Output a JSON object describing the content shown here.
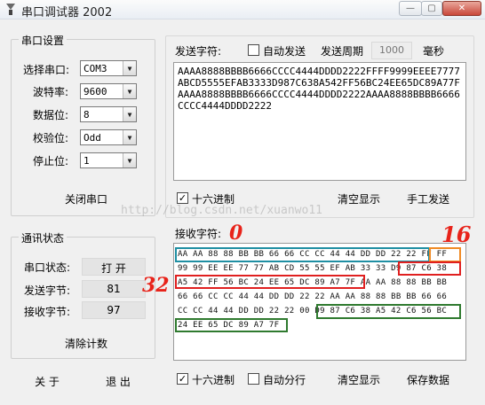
{
  "window": {
    "title": "串口调试器 2002",
    "minimize_glyph": "—",
    "maximize_glyph": "▢",
    "close_glyph": "✕"
  },
  "serial_settings": {
    "legend": "串口设置",
    "port_label": "选择串口:",
    "port_value": "COM3",
    "baud_label": "波特率:",
    "baud_value": "9600",
    "databits_label": "数据位:",
    "databits_value": "8",
    "parity_label": "校验位:",
    "parity_value": "Odd",
    "stopbits_label": "停止位:",
    "stopbits_value": "1",
    "close_port_button": "关闭串口"
  },
  "comm_status": {
    "legend": "通讯状态",
    "port_status_label": "串口状态:",
    "port_status_value": "打 开",
    "sent_bytes_label": "发送字节:",
    "sent_bytes_value": "81",
    "recv_bytes_label": "接收字节:",
    "recv_bytes_value": "97",
    "clear_count_button": "清除计数"
  },
  "bottom_left": {
    "about_button": "关 于",
    "exit_button": "退 出"
  },
  "send_section": {
    "label": "发送字符:",
    "auto_send_label": "自动发送",
    "auto_send_checked": false,
    "period_label": "发送周期",
    "period_value": "1000",
    "period_unit": "毫秒",
    "text": "AAAA8888BBBB6666CCCC4444DDDD2222FFFF9999EEEE7777ABCD5555EFAB3333D987C638A542FF56BC24EE65DC89A77FAAAA8888BBBB6666CCCC4444DDDD2222AAAA8888BBBB6666CCCC4444DDDD2222",
    "hex_label": "十六进制",
    "hex_checked": true,
    "clear_button": "清空显示",
    "manual_send_button": "手工发送"
  },
  "receive_section": {
    "label": "接收字符:",
    "lines": [
      "AA AA 88 88 BB BB 66 66 CC CC 44 44 DD DD 22 22 FF FF",
      "99 99 EE EE 77 77 AB CD 55 55 EF AB 33 33 D9 87 C6 38",
      "A5 42 FF 56 BC 24 EE 65 DC 89 A7 7F AA AA 88 88 BB BB",
      "66 66 CC CC 44 44 DD DD 22 22 AA AA 88 88 BB BB 66 66",
      "CC CC 44 44 DD DD 22 22 00 D9 87 C6 38 A5 42 C6 56 BC",
      "24 EE 65 DC 89 A7 7F"
    ],
    "hex_label": "十六进制",
    "hex_checked": true,
    "auto_newline_label": "自动分行",
    "auto_newline_checked": false,
    "clear_button": "清空显示",
    "save_button": "保存数据"
  },
  "annotations": {
    "zero": "0",
    "sixteen": "16",
    "thirty_two": "32"
  },
  "watermark": "http://blog.csdn.net/xuanwo11",
  "colors": {
    "highlight_teal": "#1f8fa3",
    "highlight_orange": "#f08a24",
    "highlight_red": "#e02020",
    "highlight_green": "#2f7a2f",
    "annotation_red": "#e8231a",
    "window_bg": "#f0f0f0"
  }
}
